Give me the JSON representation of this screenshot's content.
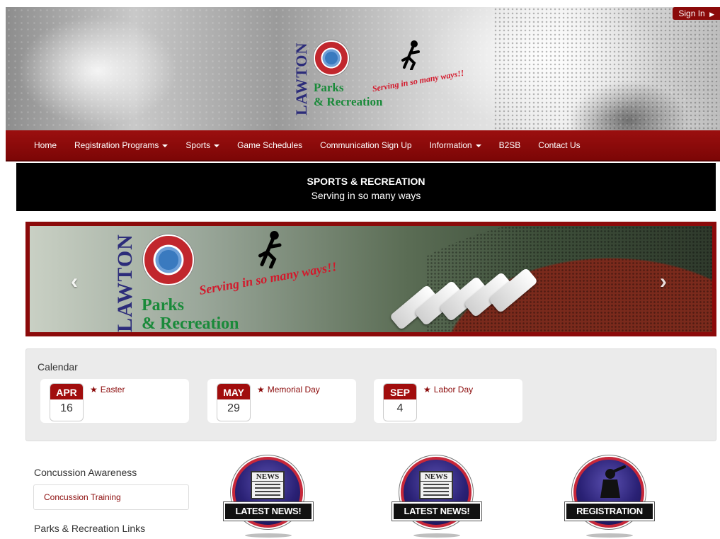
{
  "header": {
    "sign_in": "Sign In",
    "logo": {
      "lawton": "LAWTON",
      "parks": "Parks",
      "recreation": "& Recreation",
      "tagline": "Serving in so many ways!!"
    }
  },
  "nav": {
    "items": [
      {
        "label": "Home",
        "dropdown": false
      },
      {
        "label": "Registration Programs",
        "dropdown": true
      },
      {
        "label": "Sports",
        "dropdown": true
      },
      {
        "label": "Game Schedules",
        "dropdown": false
      },
      {
        "label": "Communication Sign Up",
        "dropdown": false
      },
      {
        "label": "Information",
        "dropdown": true
      },
      {
        "label": "B2SB",
        "dropdown": false
      },
      {
        "label": "Contact Us",
        "dropdown": false
      }
    ]
  },
  "title_band": {
    "title": "SPORTS & RECREATION",
    "subtitle": "Serving in so many ways"
  },
  "carousel": {
    "prev": "‹",
    "next": "›",
    "logo": {
      "lawton": "LAWTON",
      "parks": "Parks",
      "recreation": "& Recreation",
      "tagline": "Serving in so many ways!!"
    }
  },
  "calendar": {
    "title": "Calendar",
    "events": [
      {
        "month": "APR",
        "day": "16",
        "name": "Easter"
      },
      {
        "month": "MAY",
        "day": "29",
        "name": "Memorial Day"
      },
      {
        "month": "SEP",
        "day": "4",
        "name": "Labor Day"
      }
    ]
  },
  "sidebar": {
    "concussion_heading": "Concussion Awareness",
    "concussion_link": "Concussion Training",
    "links_heading": "Parks & Recreation Links"
  },
  "badges": [
    {
      "label": "LATEST NEWS!",
      "icon": "newspaper-icon",
      "paper_title": "NEWS"
    },
    {
      "label": "LATEST NEWS!",
      "icon": "newspaper-icon",
      "paper_title": "NEWS"
    },
    {
      "label": "REGISTRATION",
      "icon": "baseball-player-icon"
    }
  ],
  "colors": {
    "brand_red": "#8b0a0a",
    "nav_red": "#9b0f0f",
    "link_red": "#8b0a0a",
    "band_black": "#000000"
  }
}
